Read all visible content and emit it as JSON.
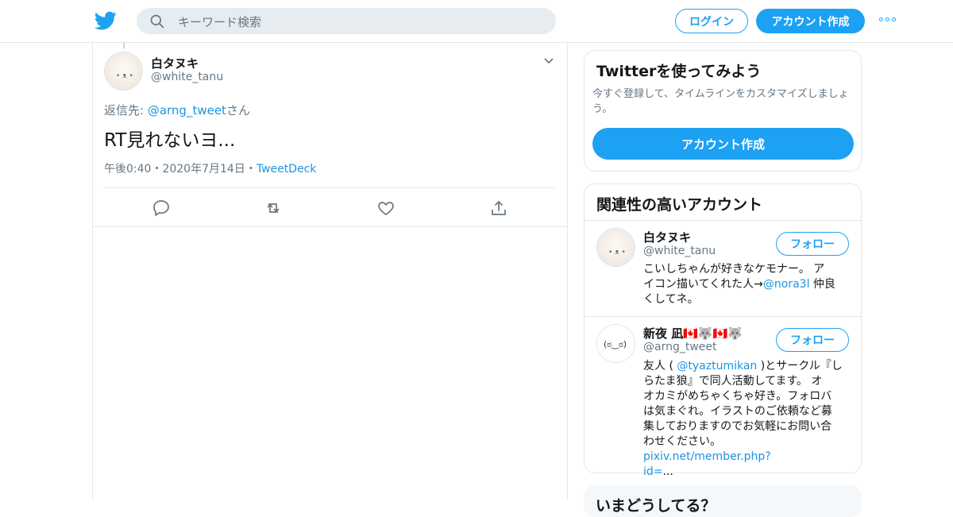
{
  "header": {
    "search_placeholder": "キーワード検索",
    "login_label": "ログイン",
    "signup_label": "アカウント作成",
    "brand_color": "#1da1f2"
  },
  "tweet": {
    "name": "白タヌキ",
    "handle": "@white_tanu",
    "reply_prefix": "返信先: ",
    "reply_to": "@arng_tweet",
    "reply_suffix": "さん",
    "text": "RT見れないヨ...",
    "time": "午後0:40",
    "date": "2020年7月14日",
    "source": "TweetDeck",
    "sep": "・",
    "actions": [
      "reply-icon",
      "retweet-icon",
      "like-icon",
      "share-icon"
    ]
  },
  "signup_card": {
    "title": "Twitterを使ってみよう",
    "subtitle": "今すぐ登録して、タイムラインをカスタマイズしましょう。",
    "button": "アカウント作成"
  },
  "related": {
    "title": "関連性の高いアカウント",
    "follow_label": "フォロー",
    "accounts": [
      {
        "name": "白タヌキ",
        "handle": "@white_tanu",
        "bio_lines": [
          "こいしちゃんが好きなケモナー。 ア",
          "イコン描いてくれた人→",
          "@nora3l",
          " 仲良",
          "くしてネ。"
        ]
      },
      {
        "name": "新夜 凪🇨🇦🐺🇨🇦🐺",
        "handle": "@arng_tweet",
        "bio": {
          "l1a": "友人 ( ",
          "l1b": "@tyaztumikan",
          "l1c": " )とサークル『し",
          "l2": "らたま狼』で同人活動してます。 オ",
          "l3": "オカミがめちゃくちゃ好き。フォロバ",
          "l4": "は気まぐれ。イラストのご依頼など募",
          "l5": "集しておりますのでお気軽にお問い合",
          "l6a": "わせください。 ",
          "l6b": "pixiv.net/member.php?",
          "l7a": "id=",
          "l7b": "..."
        }
      }
    ]
  },
  "trends_card": {
    "title": "いまどうしてる？"
  }
}
